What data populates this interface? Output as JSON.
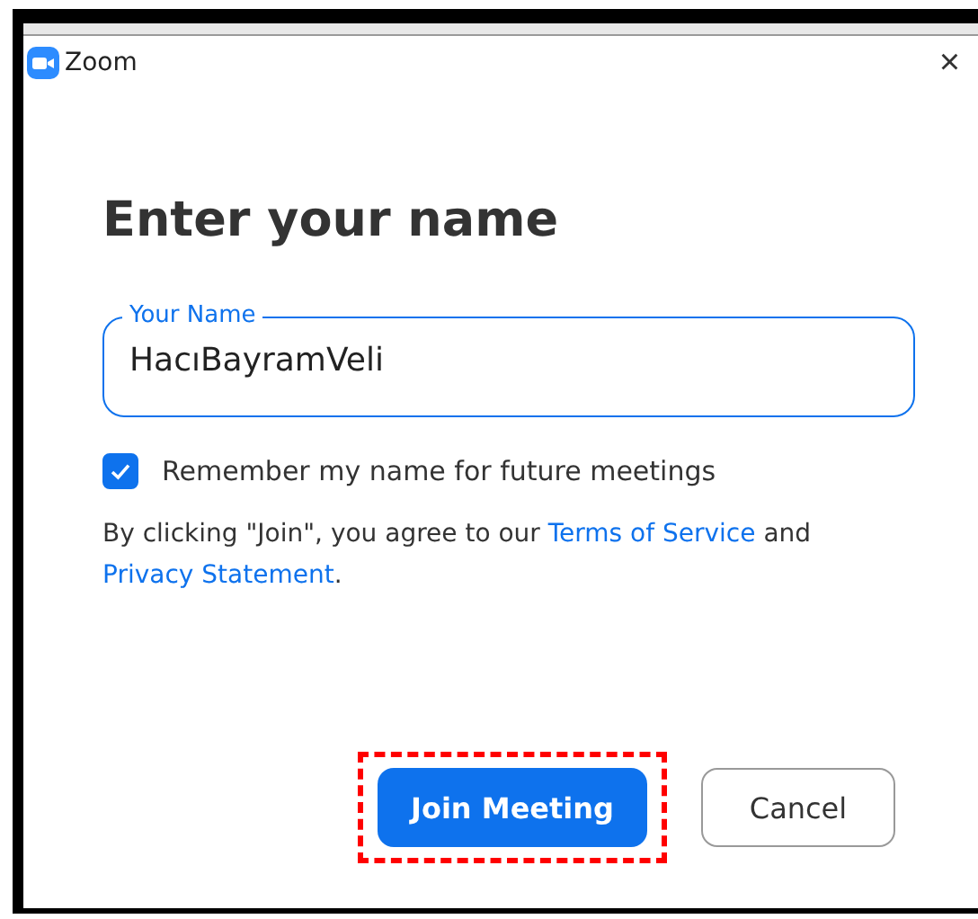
{
  "window": {
    "title": "Zoom",
    "close": "×"
  },
  "heading": "Enter your name",
  "name_field": {
    "label": "Your Name",
    "value": "HacıBayramVeli",
    "focused": true
  },
  "remember": {
    "label": "Remember my name for future meetings",
    "checked": true
  },
  "terms": {
    "before": "By clicking \"Join\", you agree to our",
    "terms_link": "Terms of Service",
    "middle": "and",
    "privacy_link": "Privacy Statement",
    "after": "."
  },
  "buttons": [
    {
      "label": "Join Meeting",
      "kind": "primary",
      "highlighted": true
    },
    {
      "label": "Cancel",
      "kind": "secondary",
      "highlighted": false
    }
  ]
}
